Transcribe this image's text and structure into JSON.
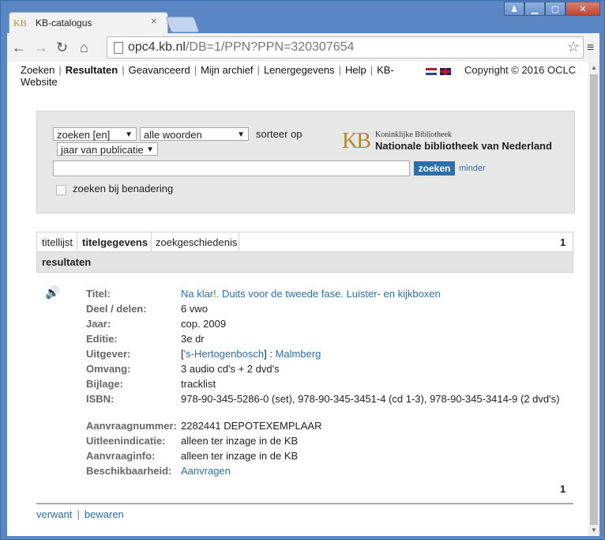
{
  "browser": {
    "tab_logo": "KB",
    "tab_title": "KB-catalogus",
    "tab_close": "×",
    "url_host": "opc4.kb.nl",
    "url_rest": "/DB=1/PPN?PPN=320307654",
    "nav_icons": [
      "back-arrow-icon",
      "forward-arrow-icon",
      "reload-icon",
      "home-icon"
    ]
  },
  "topnav": {
    "items": [
      "Zoeken",
      "Resultaten",
      "Geavanceerd",
      "Mijn archief",
      "Lenergegevens",
      "Help",
      "KB-"
    ],
    "item_website": "Website",
    "copyright": "Copyright © 2016 OCLC"
  },
  "search": {
    "select_scope": "zoeken [en]",
    "select_words": "alle woorden",
    "sort_label": "sorteer op",
    "select_sort": "jaar van publicatie",
    "query_value": "",
    "button": "zoeken",
    "less_link": "minder",
    "approx_label": "zoeken bij benadering",
    "kb_logo": "KB",
    "kb_small": "Koninklijke Bibliotheek",
    "kb_big": "Nationale bibliotheek van Nederland"
  },
  "result_tabs": {
    "tabs": [
      "titellijst",
      "titelgegevens",
      "zoekgeschiedenis"
    ],
    "page": "1",
    "results_header": "resultaten"
  },
  "record": {
    "fields": [
      {
        "label": "Titel:",
        "value": "Na klar!. Duits voor de tweede fase. Luister- en kijkboxen"
      },
      {
        "label": "Deel / delen:",
        "value": "6 vwo"
      },
      {
        "label": "Jaar:",
        "value": "cop. 2009"
      },
      {
        "label": "Editie:",
        "value": "3e dr"
      },
      {
        "label": "Uitgever:",
        "value_link1": "'s-Hertogenbosch",
        "value_mid": " : ",
        "value_link2": "Malmberg",
        "prefix": "[",
        "suffix_bracket": "]"
      },
      {
        "label": "Omvang:",
        "value": "3 audio cd's + 2 dvd's"
      },
      {
        "label": "Bijlage:",
        "value": "tracklist"
      },
      {
        "label": "ISBN:",
        "value": "978-90-345-5286-0 (set), 978-90-345-3451-4 (cd 1-3), 978-90-345-3414-9 (2 dvd's)"
      }
    ],
    "holding": [
      {
        "label": "Aanvraagnummer:",
        "value": "2282441 DEPOTEXEMPLAAR"
      },
      {
        "label": "Uitleenindicatie:",
        "value": "alleen ter inzage in de KB"
      },
      {
        "label": "Aanvraaginfo:",
        "value": "alleen ter inzage in de KB"
      },
      {
        "label": "Beschikbaarheid:",
        "value": "Aanvragen"
      }
    ],
    "page_bottom": "1"
  },
  "footer": {
    "link1": "verwant",
    "link2": "bewaren"
  }
}
